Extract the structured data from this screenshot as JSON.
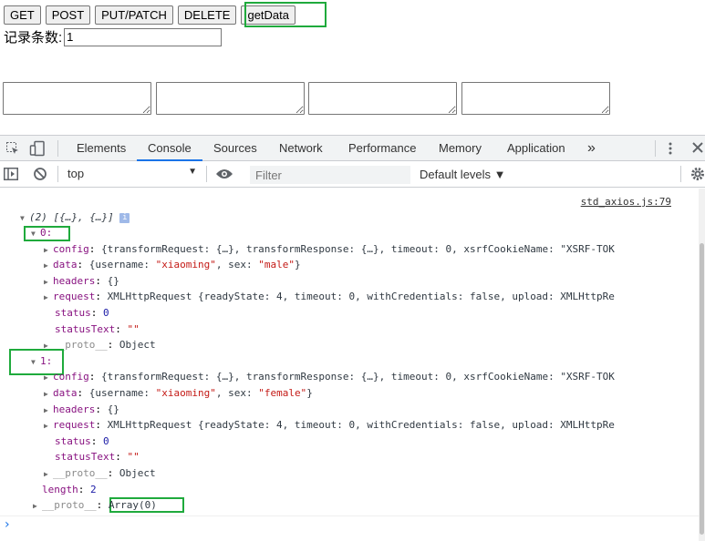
{
  "page": {
    "buttons": [
      "GET",
      "POST",
      "PUT/PATCH",
      "DELETE",
      "getData"
    ],
    "record_label": "记录条数:",
    "record_value": "1"
  },
  "devtools": {
    "tabs": [
      "Elements",
      "Console",
      "Sources",
      "Network",
      "Performance",
      "Memory",
      "Application"
    ],
    "active_tab": "Console",
    "more_tabs": "»",
    "context": "top",
    "filter_placeholder": "Filter",
    "levels": "Default levels ▼"
  },
  "console": {
    "source": "std_axios.js:79",
    "array_summary": "(2) [{…}, {…}]",
    "info_badge": "i",
    "items": [
      {
        "index": "0:",
        "config": "{transformRequest: {…}, transformResponse: {…}, timeout: 0, xsrfCookieName: \"XSRF-TOK",
        "data_user": "\"xiaoming\"",
        "data_sex": "\"male\"",
        "headers": "{}",
        "request": "XMLHttpRequest {readyState: 4, timeout: 0, withCredentials: false, upload: XMLHttpRe",
        "status": "0",
        "statusText": "\"\"",
        "proto": "Object"
      },
      {
        "index": "1:",
        "config": "{transformRequest: {…}, transformResponse: {…}, timeout: 0, xsrfCookieName: \"XSRF-TOK",
        "data_user": "\"xiaoming\"",
        "data_sex": "\"female\"",
        "headers": "{}",
        "request": "XMLHttpRequest {readyState: 4, timeout: 0, withCredentials: false, upload: XMLHttpRe",
        "status": "0",
        "statusText": "\"\"",
        "proto": "Object"
      }
    ],
    "length": "2",
    "array_proto": "Array(0)",
    "prompt": "›"
  }
}
